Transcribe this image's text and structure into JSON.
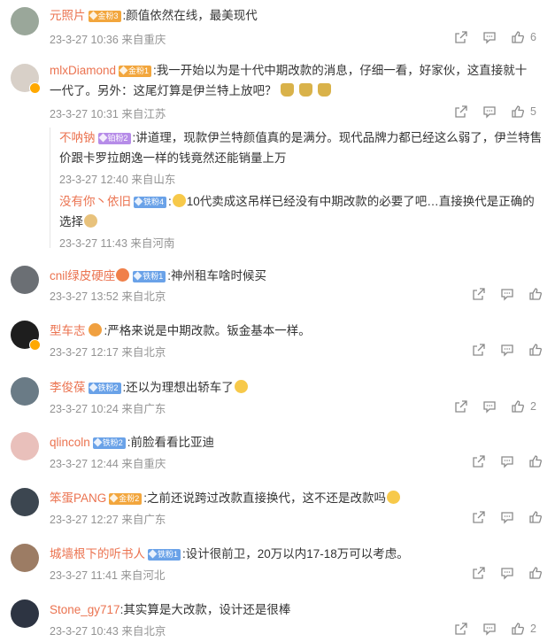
{
  "comments": [
    {
      "username": "元照片",
      "badge": "金粉3",
      "text": ":颜值依然在线，最美现代",
      "date": "23-3-27 10:36",
      "location": "来自重庆",
      "likes": "6",
      "avatar_color": "#9aa79a"
    },
    {
      "username": "mlxDiamond",
      "badge": "金粉1",
      "text": ":我一开始以为是十代中期改款的消息，仔细一看，好家伙，这直接就十一代了。另外：这尾灯算是伊兰特上放吧？",
      "date": "23-3-27 10:31",
      "location": "来自江苏",
      "likes": "5",
      "avatar_color": "#d8d0c8",
      "replies": [
        {
          "username": "不呐钠",
          "badge": "铂粉2",
          "text": ":讲道理，现款伊兰特颜值真的是满分。现代品牌力都已经这么弱了，伊兰特售价跟卡罗拉朗逸一样的钱竟然还能销量上万",
          "date": "23-3-27 12:40",
          "location": "来自山东"
        },
        {
          "username": "没有你丶依旧",
          "badge": "铁粉4",
          "text": "10代卖成这吊样已经没有中期改款的必要了吧…直接换代是正确的选择",
          "date": "23-3-27 11:43",
          "location": "来自河南"
        }
      ]
    },
    {
      "username": "cnil绿皮硬座",
      "badge": "铁粉1",
      "text": ":神州租车啥时候买",
      "date": "23-3-27 13:52",
      "location": "来自北京",
      "likes": "",
      "avatar_color": "#6b6f74"
    },
    {
      "username": "型车志",
      "badge": "",
      "text": ":严格来说是中期改款。钣金基本一样。",
      "date": "23-3-27 12:17",
      "location": "来自北京",
      "likes": "",
      "avatar_color": "#1e1e1e"
    },
    {
      "username": "李俊葆",
      "badge": "铁粉2",
      "text": ":还以为理想出轿车了",
      "date": "23-3-27 10:24",
      "location": "来自广东",
      "likes": "2",
      "avatar_color": "#6a7b86"
    },
    {
      "username": "qlincoln",
      "badge": "铁粉2",
      "text": ":前脸看看比亚迪",
      "date": "23-3-27 12:44",
      "location": "来自重庆",
      "likes": "",
      "avatar_color": "#e9c0bb"
    },
    {
      "username": "笨蛋PANG",
      "badge": "金粉2",
      "text": ":之前还说跨过改款直接换代，这不还是改款吗",
      "date": "23-3-27 12:27",
      "location": "来自广东",
      "likes": "",
      "avatar_color": "#3c4650"
    },
    {
      "username": "城墙根下的听书人",
      "badge": "铁粉1",
      "text": ":设计很前卫，20万以内17-18万可以考虑。",
      "date": "23-3-27 11:41",
      "location": "来自河北",
      "likes": "",
      "avatar_color": "#9c7c64"
    },
    {
      "username": "Stone_gy717",
      "badge": "",
      "text": ":其实算是大改款，设计还是很棒",
      "date": "23-3-27 10:43",
      "location": "来自北京",
      "likes": "2",
      "avatar_color": "#2d3442"
    }
  ],
  "icons": {
    "share": "share-icon",
    "comment": "comment-icon",
    "like": "like-icon"
  },
  "colors": {
    "username": "#eb7350",
    "meta": "#939393",
    "gold_badge": "#f2a63d",
    "iron_badge": "#6aa2e8",
    "platinum_badge": "#b68ce8"
  }
}
